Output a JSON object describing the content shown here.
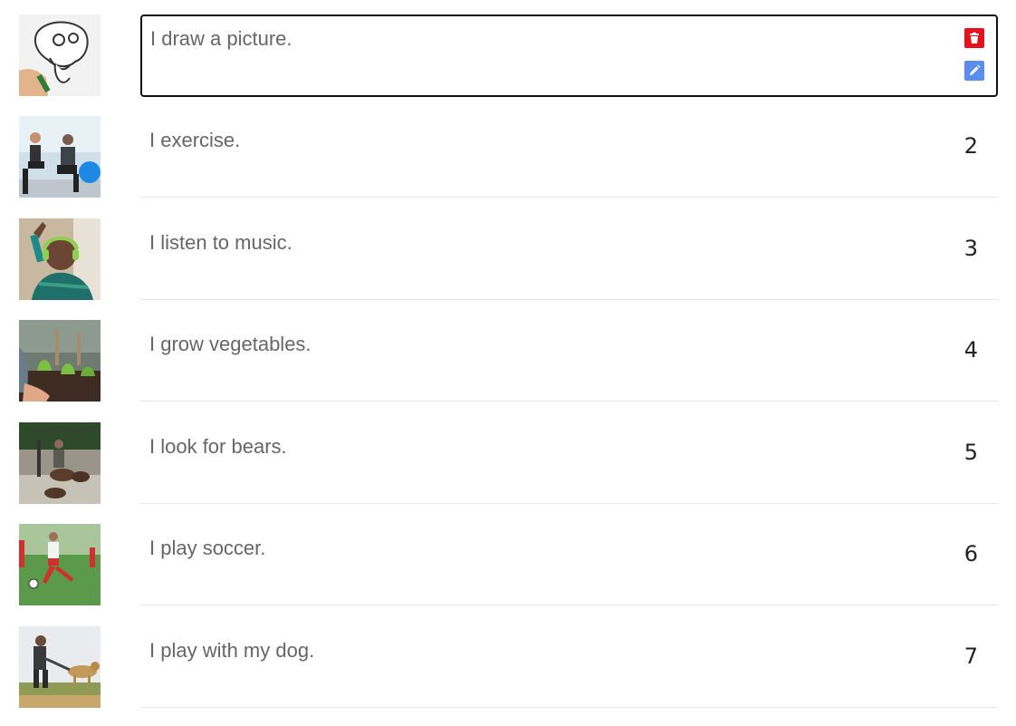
{
  "items": [
    {
      "thumb_icon": "drawing-photo",
      "text": "I draw a picture.",
      "number": ""
    },
    {
      "thumb_icon": "exercise-photo",
      "text": "I exercise.",
      "number": "2"
    },
    {
      "thumb_icon": "music-photo",
      "text": "I listen to music.",
      "number": "3"
    },
    {
      "thumb_icon": "gardening-photo",
      "text": "I grow vegetables.",
      "number": "4"
    },
    {
      "thumb_icon": "bears-photo",
      "text": "I look for bears.",
      "number": "5"
    },
    {
      "thumb_icon": "soccer-photo",
      "text": "I play soccer.",
      "number": "6"
    },
    {
      "thumb_icon": "dog-photo",
      "text": "I play with my dog.",
      "number": "7"
    }
  ],
  "actions": {
    "delete_icon": "trash-icon",
    "edit_icon": "pencil-icon",
    "delete_color": "#e8101b",
    "edit_color": "#5b8def"
  }
}
